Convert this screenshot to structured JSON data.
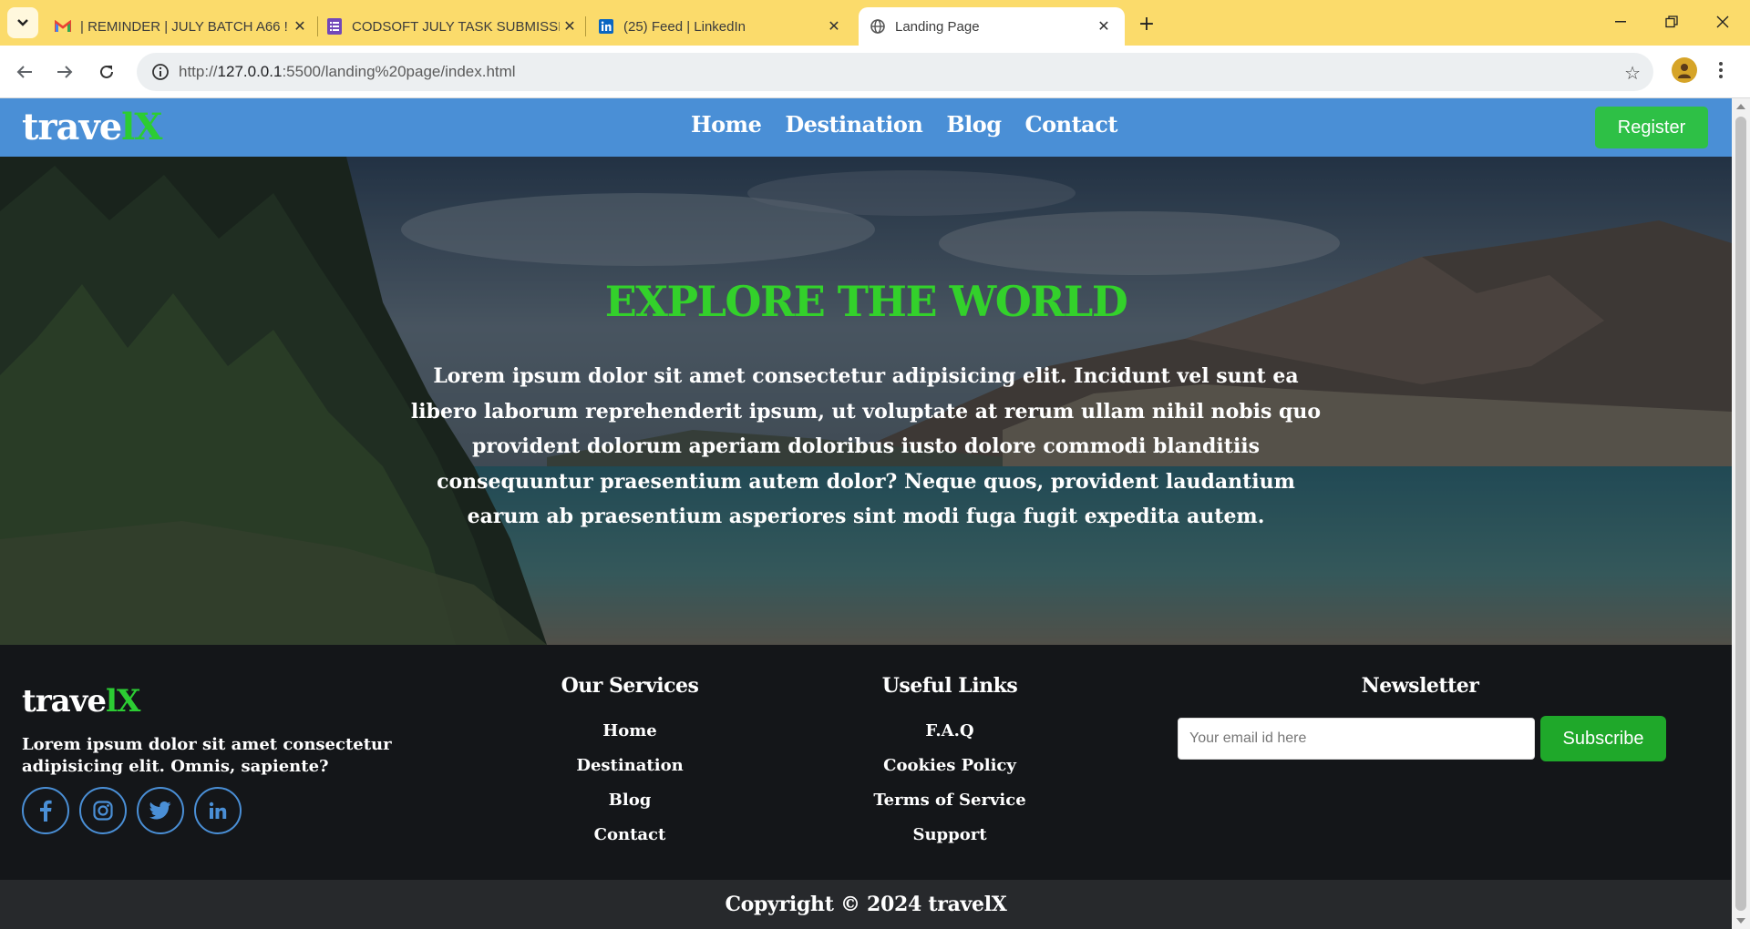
{
  "browser": {
    "tabs": [
      {
        "title": "| REMINDER | JULY BATCH A66 !",
        "icon": "gmail-icon"
      },
      {
        "title": "CODSOFT JULY TASK SUBMISSI",
        "icon": "forms-icon"
      },
      {
        "title": "(25) Feed | LinkedIn",
        "icon": "linkedin-icon"
      },
      {
        "title": "Landing Page",
        "icon": "globe-icon"
      }
    ],
    "url_prefix": "http://",
    "url_host": "127.0.0.1",
    "url_rest": ":5500/landing%20page/index.html"
  },
  "site": {
    "logo_main": "trave",
    "logo_accent": "lX",
    "nav": [
      "Home",
      "Destination",
      "Blog",
      "Contact"
    ],
    "register_label": "Register",
    "brand_colors": {
      "header": "#4a8fd6",
      "accent": "#2ccc33",
      "button": "#2ec046"
    }
  },
  "hero": {
    "title": "EXPLORE THE WORLD",
    "text": "Lorem ipsum dolor sit amet consectetur adipisicing elit. Incidunt vel sunt ea libero laborum reprehenderit ipsum, ut voluptate at rerum ullam nihil nobis quo provident dolorum aperiam doloribus iusto dolore commodi blanditiis consequuntur praesentium autem dolor? Neque quos, provident laudantium earum ab praesentium asperiores sint modi fuga fugit expedita autem."
  },
  "footer": {
    "logo_main": "trave",
    "logo_accent": "lX",
    "about": "Lorem ipsum dolor sit amet consectetur adipisicing elit. Omnis, sapiente?",
    "socials": [
      "facebook-icon",
      "instagram-icon",
      "twitter-icon",
      "linkedin-icon"
    ],
    "services_title": "Our Services",
    "services": [
      "Home",
      "Destination",
      "Blog",
      "Contact"
    ],
    "links_title": "Useful Links",
    "links": [
      "F.A.Q",
      "Cookies Policy",
      "Terms of Service",
      "Support"
    ],
    "newsletter_title": "Newsletter",
    "email_placeholder": "Your email id here",
    "subscribe_label": "Subscribe",
    "copyright": "Copyright © 2024 travelX"
  }
}
